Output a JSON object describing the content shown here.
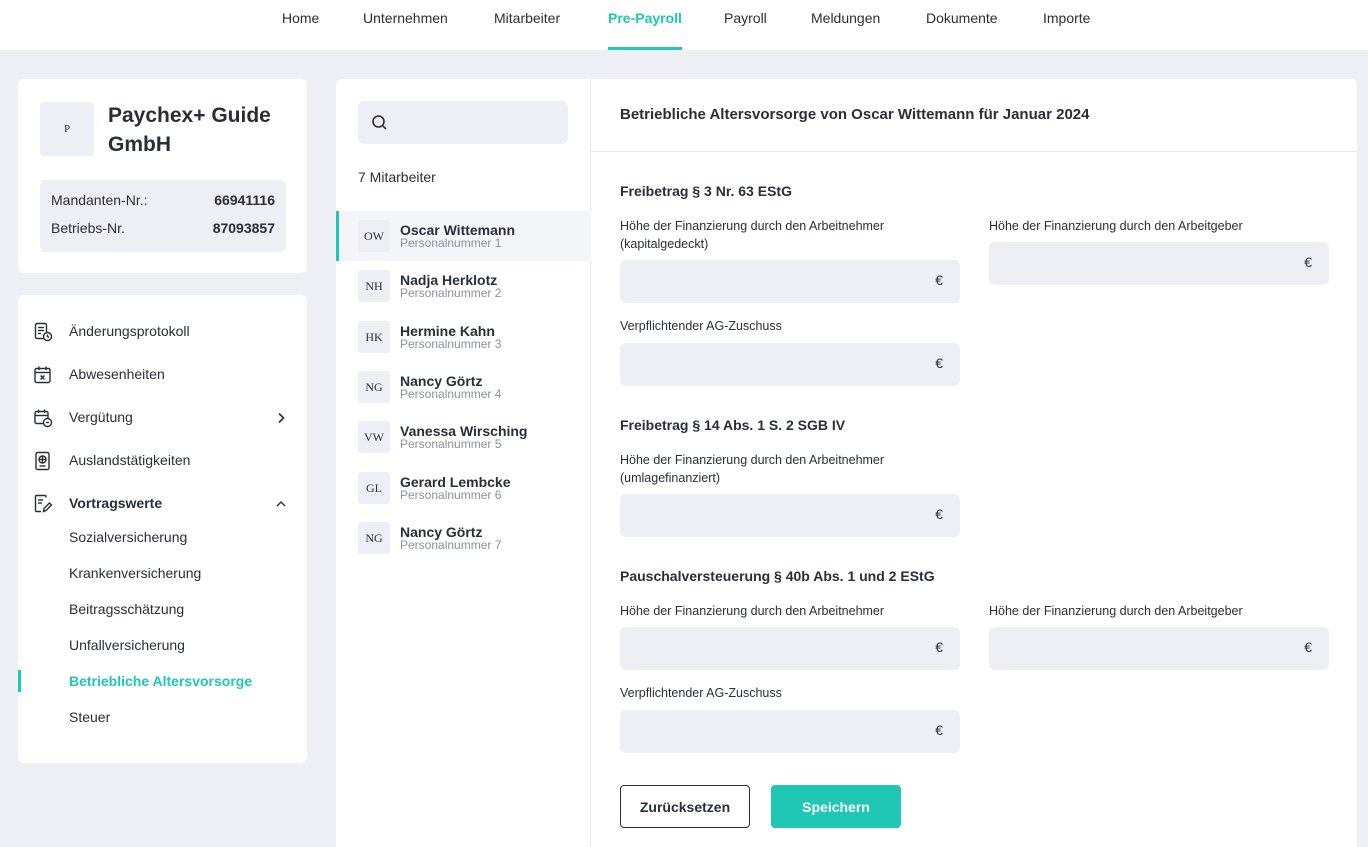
{
  "topnav": {
    "items": [
      {
        "label": "Home"
      },
      {
        "label": "Unternehmen"
      },
      {
        "label": "Mitarbeiter"
      },
      {
        "label": "Pre-Payroll",
        "active": true
      },
      {
        "label": "Payroll"
      },
      {
        "label": "Meldungen"
      },
      {
        "label": "Dokumente"
      },
      {
        "label": "Importe"
      }
    ]
  },
  "company": {
    "logo_text": "P",
    "name": "Paychex+ Guide GmbH",
    "mandant_label": "Mandanten-Nr.:",
    "mandant_value": "66941116",
    "betrieb_label": "Betriebs-Nr.",
    "betrieb_value": "87093857"
  },
  "menu": {
    "items": [
      {
        "label": "Änderungsprotokoll",
        "icon": "document-clock-icon"
      },
      {
        "label": "Abwesenheiten",
        "icon": "calendar-x-icon"
      },
      {
        "label": "Vergütung",
        "icon": "calendar-money-icon"
      },
      {
        "label": "Auslandstätigkeiten",
        "icon": "passport-icon"
      },
      {
        "label": "Vortragswerte",
        "icon": "edit-document-icon"
      }
    ],
    "sub_items": [
      {
        "label": "Sozialversicherung"
      },
      {
        "label": "Krankenversicherung"
      },
      {
        "label": "Beitragsschätzung"
      },
      {
        "label": "Unfallversicherung"
      },
      {
        "label": "Betriebliche Altersvorsorge",
        "active": true
      },
      {
        "label": "Steuer"
      }
    ]
  },
  "employees": {
    "search_value": "",
    "count_label": "7 Mitarbeiter",
    "list": [
      {
        "initials": "OW",
        "name": "Oscar Wittemann",
        "number": "Personalnummer 1",
        "active": true
      },
      {
        "initials": "NH",
        "name": "Nadja Herklotz",
        "number": "Personalnummer 2"
      },
      {
        "initials": "HK",
        "name": "Hermine Kahn",
        "number": "Personalnummer 3"
      },
      {
        "initials": "NG",
        "name": "Nancy Görtz",
        "number": "Personalnummer 4"
      },
      {
        "initials": "VW",
        "name": "Vanessa Wirsching",
        "number": "Personalnummer 5"
      },
      {
        "initials": "GL",
        "name": "Gerard Lembcke",
        "number": "Personalnummer 6"
      },
      {
        "initials": "NG",
        "name": "Nancy Görtz",
        "number": "Personalnummer 7"
      }
    ]
  },
  "form": {
    "title": "Betriebliche Altersvorsorge von Oscar Wittemann für Januar 2024",
    "currency": "€",
    "sec1": {
      "title": "Freibetrag § 3 Nr. 63 EStG",
      "an_label": "Höhe der Finanzierung durch den Arbeitnehmer (kapitalgedeckt)",
      "ag_label": "Höhe der Finanzierung durch den Arbeitgeber",
      "zuschuss_label": "Verpflichtender AG-Zuschuss"
    },
    "sec2": {
      "title": "Freibetrag § 14 Abs. 1 S. 2 SGB IV",
      "an_label": "Höhe der Finanzierung durch den Arbeitnehmer (umlagefinanziert)"
    },
    "sec3": {
      "title": "Pauschalversteuerung § 40b Abs. 1 und 2 EStG",
      "an_label": "Höhe der Finanzierung durch den Arbeitnehmer",
      "ag_label": "Höhe der Finanzierung durch den Arbeitgeber",
      "zuschuss_label": "Verpflichtender AG-Zuschuss"
    },
    "reset_label": "Zurücksetzen",
    "save_label": "Speichern"
  },
  "colors": {
    "accent": "#1fc7b4",
    "background": "#edeff4",
    "text": "#2a2e38"
  }
}
